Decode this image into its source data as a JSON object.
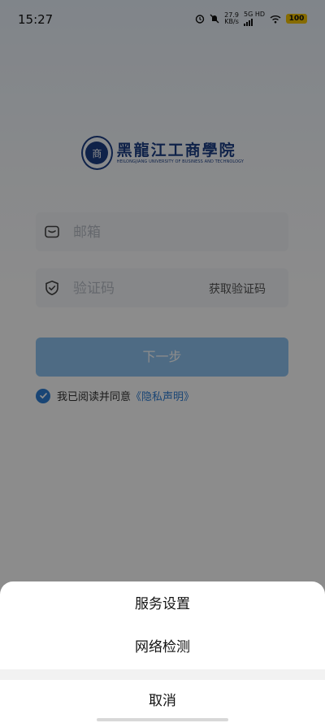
{
  "status_bar": {
    "time": "15:27",
    "speed_value": "27.9",
    "speed_unit": "KB/s",
    "network": "5G HD",
    "battery": "100"
  },
  "logo": {
    "name_cn": "黑龍江工商學院",
    "name_en": "HEILONGJIANG UNIVERSITY OF BUSINESS AND TECHNOLOGY"
  },
  "form": {
    "email_placeholder": "邮箱",
    "code_placeholder": "验证码",
    "get_code_label": "获取验证码",
    "next_label": "下一步",
    "agreement_text": "我已阅读并同意",
    "privacy_link": "《隐私声明》",
    "agreement_checked": true
  },
  "action_sheet": {
    "items": [
      "服务设置",
      "网络检测"
    ],
    "cancel_label": "取消"
  },
  "colors": {
    "brand": "#1d3f86",
    "accent": "#2f7fd6",
    "overlay": "rgba(0,0,0,0.45)"
  }
}
